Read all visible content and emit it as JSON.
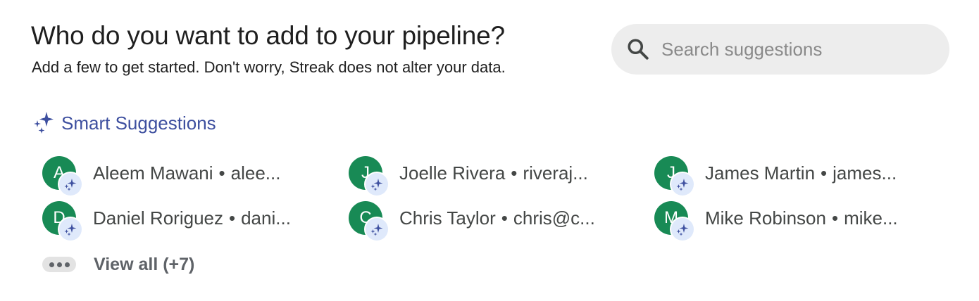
{
  "header": {
    "title": "Who do you want to add to your pipeline?",
    "subtitle": "Add a few to get started. Don't worry, Streak does not alter your data."
  },
  "search": {
    "placeholder": "Search suggestions",
    "value": "",
    "icon": "search-icon"
  },
  "smart_suggestions": {
    "icon": "sparkle-icon",
    "label": "Smart Suggestions",
    "people": [
      {
        "initial": "A",
        "name": "Aleem Mawani",
        "separator": "•",
        "email": "alee..."
      },
      {
        "initial": "J",
        "name": "Joelle Rivera",
        "separator": "•",
        "email": "riveraj..."
      },
      {
        "initial": "J",
        "name": "James Martin",
        "separator": "•",
        "email": "james..."
      },
      {
        "initial": "D",
        "name": "Daniel Roriguez",
        "separator": "•",
        "email": "dani..."
      },
      {
        "initial": "C",
        "name": "Chris Taylor",
        "separator": "•",
        "email": "chris@c..."
      },
      {
        "initial": "M",
        "name": "Mike Robinson",
        "separator": "•",
        "email": "mike..."
      }
    ]
  },
  "view_all": {
    "icon": "more-horizontal-icon",
    "label": "View all (+7)"
  },
  "colors": {
    "avatar_bg": "#188a55",
    "accent": "#3d4f9f",
    "badge_bg": "#dfe9fb",
    "search_bg": "#ededed"
  }
}
